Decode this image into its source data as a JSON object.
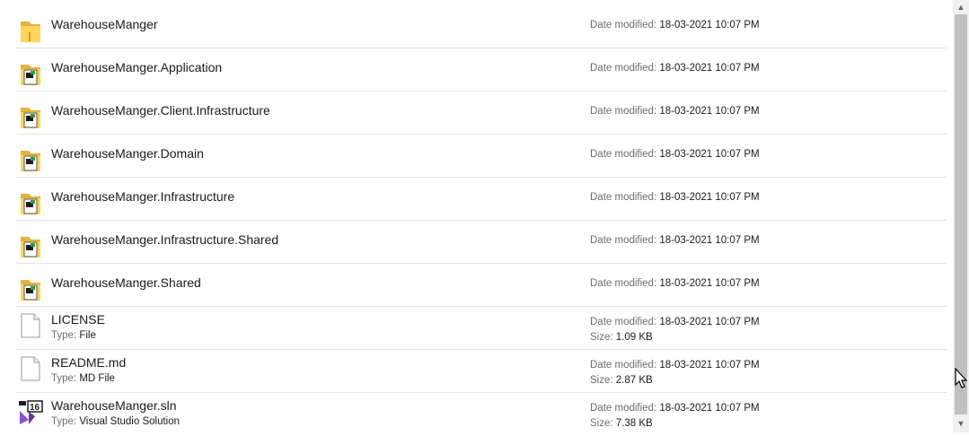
{
  "items": [
    {
      "name": "WarehouseManger",
      "icon": "folder-icon",
      "date_label": "Date modified:",
      "date": "18-03-2021 10:07 PM"
    },
    {
      "name": "WarehouseManger.Application",
      "icon": "project-folder-icon",
      "date_label": "Date modified:",
      "date": "18-03-2021 10:07 PM"
    },
    {
      "name": "WarehouseManger.Client.Infrastructure",
      "icon": "project-folder-icon",
      "date_label": "Date modified:",
      "date": "18-03-2021 10:07 PM"
    },
    {
      "name": "WarehouseManger.Domain",
      "icon": "project-folder-icon",
      "date_label": "Date modified:",
      "date": "18-03-2021 10:07 PM"
    },
    {
      "name": "WarehouseManger.Infrastructure",
      "icon": "project-folder-icon",
      "date_label": "Date modified:",
      "date": "18-03-2021 10:07 PM"
    },
    {
      "name": "WarehouseManger.Infrastructure.Shared",
      "icon": "project-folder-icon",
      "date_label": "Date modified:",
      "date": "18-03-2021 10:07 PM"
    },
    {
      "name": "WarehouseManger.Shared",
      "icon": "project-folder-icon",
      "date_label": "Date modified:",
      "date": "18-03-2021 10:07 PM"
    },
    {
      "name": "LICENSE",
      "icon": "file-icon",
      "type_label": "Type:",
      "type": "File",
      "date_label": "Date modified:",
      "date": "18-03-2021 10:07 PM",
      "size_label": "Size:",
      "size": "1.09 KB"
    },
    {
      "name": "README.md",
      "icon": "file-icon",
      "type_label": "Type:",
      "type": "MD File",
      "date_label": "Date modified:",
      "date": "18-03-2021 10:07 PM",
      "size_label": "Size:",
      "size": "2.87 KB"
    },
    {
      "name": "WarehouseManger.sln",
      "icon": "visual-studio-solution-icon",
      "type_label": "Type:",
      "type": "Visual Studio Solution",
      "date_label": "Date modified:",
      "date": "18-03-2021 10:07 PM",
      "size_label": "Size:",
      "size": "7.38 KB"
    }
  ],
  "colors": {
    "folder": "#ffd55c",
    "folder_dark": "#e6b33a",
    "separator": "#e3e3e3",
    "vs_purple": "#8c4fd0"
  },
  "scrollbar": {
    "up_icon": "scroll-up-arrow-icon",
    "down_icon": "scroll-down-arrow-icon",
    "position": 0.95
  }
}
